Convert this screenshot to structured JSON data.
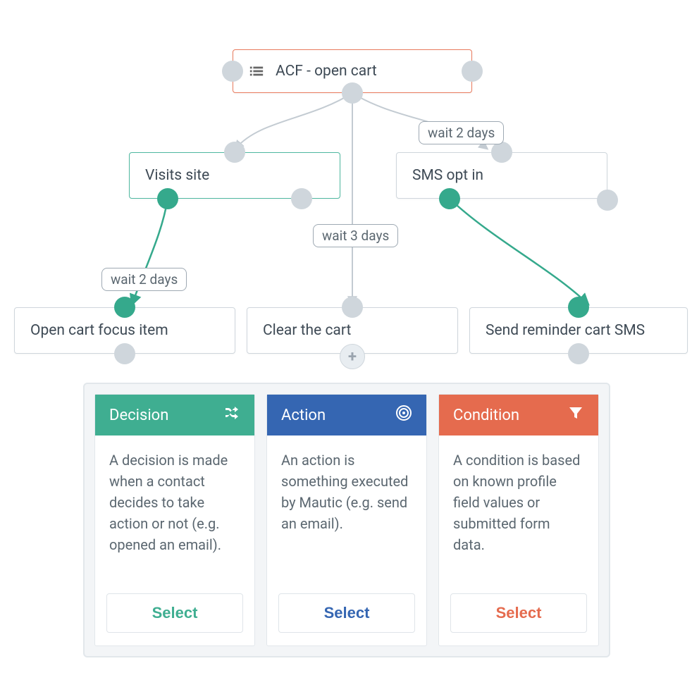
{
  "nodes": {
    "root": {
      "label": "ACF - open cart"
    },
    "visits": {
      "label": "Visits site"
    },
    "smsopt": {
      "label": "SMS opt in"
    },
    "open_cart": {
      "label": "Open cart focus item"
    },
    "clear": {
      "label": "Clear the cart"
    },
    "send_sms": {
      "label": "Send reminder cart SMS"
    }
  },
  "labels": {
    "wait2_a": "wait 2 days",
    "wait2_b": "wait 2 days",
    "wait3": "wait 3 days"
  },
  "cards": {
    "decision": {
      "title": "Decision",
      "body": "A decision is made when a contact decides to take action or not (e.g. opened an email).",
      "button": "Select"
    },
    "action": {
      "title": "Action",
      "body": "An action is something executed by Mautic (e.g. send an email).",
      "button": "Select"
    },
    "condition": {
      "title": "Condition",
      "body": "A condition is based on known profile field values or submitted form data.",
      "button": "Select"
    }
  }
}
